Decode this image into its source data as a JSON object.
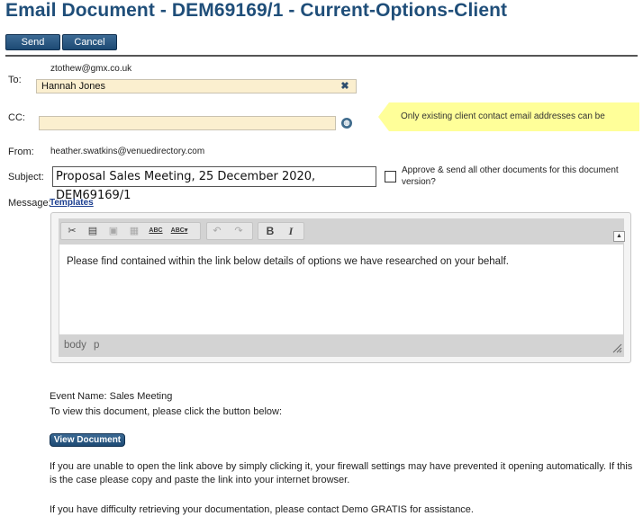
{
  "page": {
    "title": "Email Document - DEM69169/1 - Current-Options-Client"
  },
  "toolbar": {
    "send_label": "Send",
    "cancel_label": "Cancel"
  },
  "to": {
    "label": "To:",
    "email": "ztothew@gmx.co.uk",
    "recipient": "Hannah Jones",
    "remove_icon": "close-icon"
  },
  "cc": {
    "label": "CC:",
    "value": "",
    "lookup_icon": "globe-icon",
    "tooltip": "Only existing client contact email addresses can be selected."
  },
  "from": {
    "label": "From:",
    "value": "heather.swatkins@venuedirectory.com"
  },
  "subject": {
    "label": "Subject:",
    "value": "Proposal Sales Meeting, 25 December 2020, DEM69169/1",
    "approve_checked": false,
    "approve_label": "Approve & send all other documents for this document version?"
  },
  "message": {
    "label": "Message:",
    "templates_label": "Templates",
    "editor": {
      "tools": [
        "cut-icon",
        "copy-icon",
        "paste-icon",
        "paste-word-icon",
        "spellcheck-icon",
        "spellcheck-as-you-type-icon",
        "undo-icon",
        "redo-icon",
        "bold-icon",
        "italic-icon"
      ],
      "spell1_label": "ABC",
      "spell2_label": "ABC",
      "bold_label": "B",
      "italic_label": "I",
      "content": "Please find contained within the link below details of options we have researched on your behalf.",
      "status_path": [
        "body",
        "p"
      ]
    }
  },
  "body_text": {
    "event_name": "Event Name: Sales Meeting",
    "view_instruction": "To view this document, please click the button below:",
    "view_button_label": "View Document",
    "firewall_note": "If you are unable to open the link above by simply clicking it, your firewall settings may have prevented it opening automatically. If this is the case please copy and paste the link into your internet browser.",
    "assistance_note": "If you have difficulty retrieving your documentation, please contact Demo GRATIS for assistance."
  },
  "colors": {
    "title": "#1f4e79",
    "button": "#1d4a74",
    "field_bg": "#fbefcf",
    "tooltip_bg": "#ffff99",
    "link": "#1a3d8f"
  }
}
